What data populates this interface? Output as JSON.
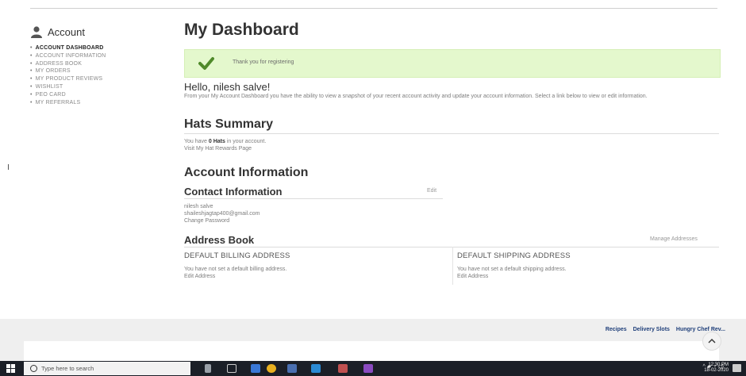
{
  "sidebar": {
    "title": "Account",
    "items": [
      {
        "label": "ACCOUNT DASHBOARD",
        "active": true
      },
      {
        "label": "ACCOUNT INFORMATION",
        "active": false
      },
      {
        "label": "ADDRESS BOOK",
        "active": false
      },
      {
        "label": "MY ORDERS",
        "active": false
      },
      {
        "label": "MY PRODUCT REVIEWS",
        "active": false
      },
      {
        "label": "WISHLIST",
        "active": false
      },
      {
        "label": "PEO CARD",
        "active": false
      },
      {
        "label": "MY REFERRALS",
        "active": false
      }
    ]
  },
  "main": {
    "title": "My Dashboard",
    "success_message": "Thank you for registering",
    "hello": "Hello, nilesh salve!",
    "intro": "From your My Account Dashboard you have the ability to view a snapshot of your recent account activity and update your account information. Select a link below to view or edit information.",
    "hats": {
      "heading": "Hats Summary",
      "line_prefix": "You have ",
      "count_text": "0 Hats",
      "line_suffix": " in your account.",
      "link": "Visit My Hat Rewards Page"
    },
    "account_info": {
      "heading": "Account Information",
      "contact_heading": "Contact Information",
      "edit": "Edit",
      "name": "nilesh salve",
      "email": "shaileshjagtap400@gmail.com",
      "change_password": "Change Password"
    },
    "address_book": {
      "heading": "Address Book",
      "manage": "Manage Addresses",
      "billing_title": "DEFAULT BILLING ADDRESS",
      "billing_text": "You have not set a default billing address.",
      "billing_edit": "Edit Address",
      "shipping_title": "DEFAULT SHIPPING ADDRESS",
      "shipping_text": "You have not set a default shipping address.",
      "shipping_edit": "Edit Address"
    }
  },
  "footer": {
    "links": [
      "Recipes",
      "Delivery Slots",
      "Hungry Chef Rev..."
    ]
  },
  "taskbar": {
    "search_placeholder": "Type here to search",
    "time": "12:30 PM",
    "date": "18-02-2020"
  },
  "colors": {
    "success_bg": "#e4f8cd",
    "check": "#4f8a2a",
    "footer_link": "#1f3f7a",
    "taskbar": "#1b1f27"
  }
}
